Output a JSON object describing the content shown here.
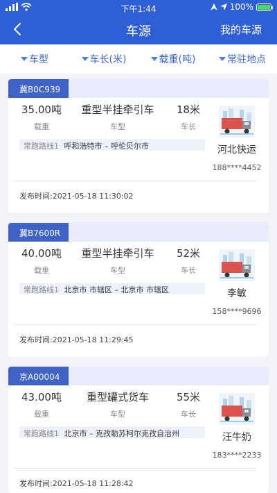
{
  "status_bar": {
    "time": "下午1:44",
    "battery": "100%"
  },
  "nav": {
    "title": "车源",
    "right_link": "我的车源"
  },
  "filters": [
    {
      "label": "车型"
    },
    {
      "label": "车长(米)"
    },
    {
      "label": "载重(吨)"
    },
    {
      "label": "常驻地点"
    }
  ],
  "cards": [
    {
      "plate": "冀B0C939",
      "weight": "35.00吨",
      "weight_label": "载重",
      "type": "重型半挂牵引车",
      "type_label": "车型",
      "length": "18米",
      "length_label": "车长",
      "route_label": "常跑路线1",
      "route": "呼和浩特市 – 呼伦贝尔市",
      "company": "河北快运",
      "phone": "188****4452",
      "publish_time": "发布时间:2021-05-18 11:30:02"
    },
    {
      "plate": "冀B7600R",
      "weight": "40.00吨",
      "weight_label": "载重",
      "type": "重型半挂牵引车",
      "type_label": "车型",
      "length": "52米",
      "length_label": "车长",
      "route_label": "常跑路线1",
      "route": "北京市 市辖区 – 北京市 市辖区",
      "company": "李敏",
      "phone": "158****9696",
      "publish_time": "发布时间:2021-05-18 11:29:45"
    },
    {
      "plate": "京A00004",
      "weight": "43.00吨",
      "weight_label": "载重",
      "type": "重型罐式货车",
      "type_label": "车型",
      "length": "55米",
      "length_label": "车长",
      "route_label": "常跑路线1",
      "route": "北京市 – 克孜勒苏柯尔克孜自治州",
      "company": "汪牛奶",
      "phone": "183****2233",
      "publish_time": "发布时间:2021-05-18 11:28:42"
    }
  ]
}
